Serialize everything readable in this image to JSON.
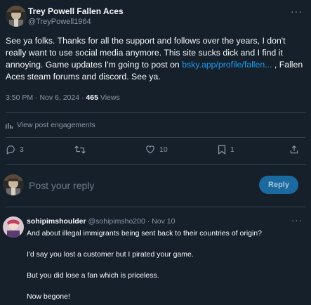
{
  "post": {
    "author_name": "Trey Powell Fallen Aces",
    "author_handle": "@TreyPowell1964",
    "text_before_link": "See ya folks. Thanks for all the support and follows over the years, I don't really want to use social media anymore. This site sucks dick and I find it annoying. Game updates I'm going to post on ",
    "link_text": "bsky.app/profile/fallen...",
    "text_after_link": " , Fallen Aces steam forums and discord.  See ya.",
    "time": "3:50 PM",
    "date": "Nov 6, 2024",
    "views_count": "465",
    "views_label": "Views",
    "engagements_label": "View post engagements",
    "more_icon": "more-horizontal-icon"
  },
  "actions": {
    "reply_count": "3",
    "retweet_count": "",
    "like_count": "10",
    "bookmark_count": "1"
  },
  "reply_box": {
    "placeholder": "Post your reply",
    "button_label": "Reply"
  },
  "comment": {
    "author_name": "sohipimshoulder",
    "author_handle": "@sohipimsho200",
    "date": "Nov 10",
    "lines": [
      "And about illegal immigrants being sent back to their countries of origin?",
      "I'd say you lost a customer but I pirated your game.",
      "But you did lose a fan which is priceless.",
      "Now begone!"
    ]
  },
  "colors": {
    "background": "#15202b",
    "text": "#f7f9f9",
    "muted": "#8b98a5",
    "link": "#1d9bf0",
    "divider": "#38444d",
    "reply_button": "#1a6aa0"
  }
}
